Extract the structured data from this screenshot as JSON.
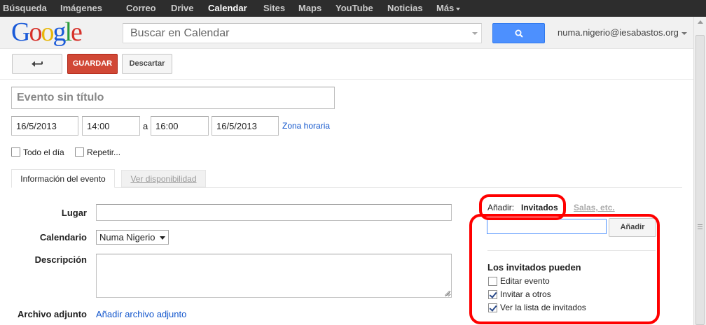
{
  "topnav": {
    "items": [
      "Búsqueda",
      "Imágenes",
      "Correo",
      "Drive",
      "Calendar",
      "Sites",
      "Maps",
      "YouTube",
      "Noticias",
      "Más"
    ],
    "active": "Calendar"
  },
  "header": {
    "logo": [
      "G",
      "o",
      "o",
      "g",
      "l",
      "e"
    ],
    "logo_colors": [
      "#1a5ad8",
      "#d6312a",
      "#e8b70a",
      "#1a5ad8",
      "#2a9b3c",
      "#d6312a"
    ],
    "search_placeholder": "Buscar en Calendar",
    "account": "numa.nigerio@iesabastos.org"
  },
  "toolbar": {
    "save_label": "GUARDAR",
    "discard_label": "Descartar"
  },
  "event": {
    "title_placeholder": "Evento sin título",
    "start_date": "16/5/2013",
    "start_time": "14:00",
    "to_label": "a",
    "end_time": "16:00",
    "end_date": "16/5/2013",
    "timezone_link": "Zona horaria",
    "allday_label": "Todo el día",
    "repeat_label": "Repetir..."
  },
  "tabs": {
    "info": "Información del evento",
    "availability": "Ver disponibilidad"
  },
  "form": {
    "lugar_label": "Lugar",
    "calendar_label": "Calendario",
    "calendar_value": "Numa Nigerio",
    "description_label": "Descripción",
    "attachment_label": "Archivo adjunto",
    "attachment_link": "Añadir archivo adjunto"
  },
  "guests_panel": {
    "add_label": "Añadir:",
    "guests_tab": "Invitados",
    "rooms_tab": "Salas, etc.",
    "add_button": "Añadir",
    "permissions_title": "Los invitados pueden",
    "permissions": [
      {
        "label": "Editar evento",
        "checked": false
      },
      {
        "label": "Invitar a otros",
        "checked": true
      },
      {
        "label": "Ver la lista de invitados",
        "checked": true
      }
    ]
  },
  "colors": {
    "save_button": "#d14836",
    "search_button": "#4d90fe",
    "link": "#1155cc",
    "annotation": "#ff0000"
  }
}
